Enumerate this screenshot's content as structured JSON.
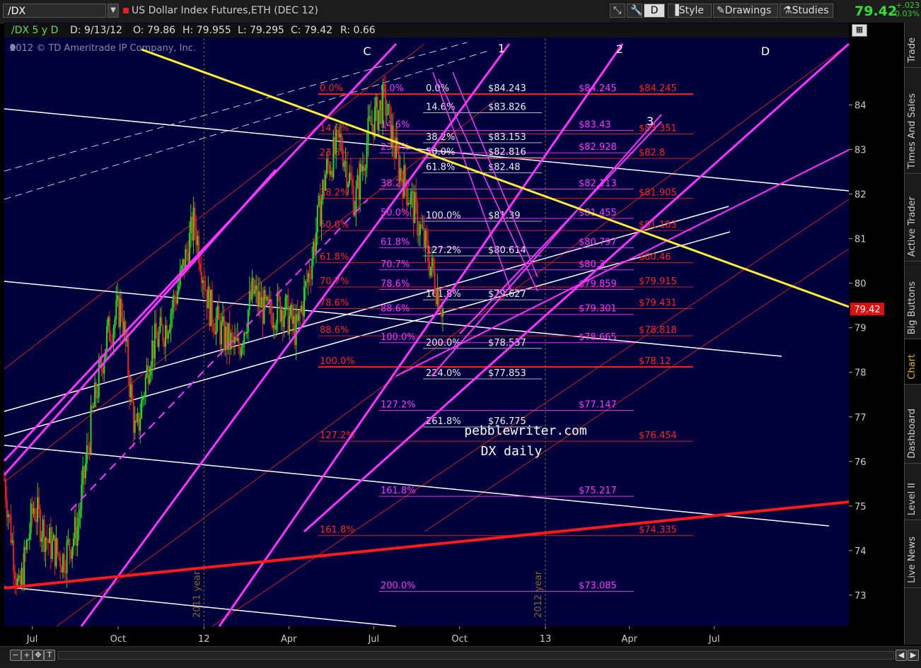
{
  "toolbar": {
    "symbol": "/DX",
    "description": "US Dollar Index Futures,ETH (DEC 12)",
    "aggregation_btn": "D",
    "style_label": "Style",
    "drawings_label": "Drawings",
    "studies_label": "Studies",
    "last_price": "79.42",
    "net_change": "+.023",
    "pct_change": "+0.03%"
  },
  "infobar": {
    "symbol_period": "/DX 5 y D",
    "date": "D: 9/13/12",
    "open": "O: 79.86",
    "high": "H: 79.955",
    "low": "L: 79.295",
    "close": "C: 79.42",
    "range": "R: 0.66"
  },
  "copyright": "2012 © TD Ameritrade IP Company, Inc.",
  "watermark": {
    "line1": "pebblewriter.com",
    "line2": "DX daily"
  },
  "right_tabs": [
    "Trade",
    "Times And Sales",
    "Active Trader",
    "Big Buttons",
    "Chart",
    "Dashboard",
    "Level II",
    "Live News"
  ],
  "colors": {
    "background": "#00003c",
    "bull": "#22dd22",
    "bear": "#ee2222",
    "magenta": "#ff33ff",
    "fib_red": "#ff2222",
    "yellow": "#ffee33",
    "price_label": "#dd1111"
  },
  "chart_data": {
    "type": "candlestick",
    "title": "US Dollar Index Futures,ETH (DEC 12)",
    "ylim": [
      72.3,
      85.5
    ],
    "y_ticks": [
      73,
      74,
      75,
      76,
      77,
      78,
      79,
      80,
      81,
      82,
      83,
      84
    ],
    "x_tick_labels": [
      "Jul",
      "Oct",
      "12",
      "Apr",
      "Jul",
      "Oct",
      "13",
      "Apr",
      "Jul"
    ],
    "current_price": "79.42",
    "year_markers": [
      "2011 year",
      "2012 year"
    ],
    "close_path": [
      {
        "t": "2011-06",
        "v": 75.6
      },
      {
        "t": "2011-06",
        "v": 73.0
      },
      {
        "t": "2011-07",
        "v": 75.0
      },
      {
        "t": "2011-07",
        "v": 74.2
      },
      {
        "t": "2011-08",
        "v": 73.8
      },
      {
        "t": "2011-08",
        "v": 74.5
      },
      {
        "t": "2011-09",
        "v": 77.0
      },
      {
        "t": "2011-09",
        "v": 78.8
      },
      {
        "t": "2011-10",
        "v": 79.5
      },
      {
        "t": "2011-10",
        "v": 76.5
      },
      {
        "t": "2011-11",
        "v": 78.5
      },
      {
        "t": "2011-11",
        "v": 79.0
      },
      {
        "t": "2011-12",
        "v": 80.0
      },
      {
        "t": "2012-01",
        "v": 81.4
      },
      {
        "t": "2012-01",
        "v": 79.5
      },
      {
        "t": "2012-02",
        "v": 78.8
      },
      {
        "t": "2012-02",
        "v": 78.5
      },
      {
        "t": "2012-03",
        "v": 79.8
      },
      {
        "t": "2012-03",
        "v": 79.3
      },
      {
        "t": "2012-04",
        "v": 79.5
      },
      {
        "t": "2012-04",
        "v": 78.9
      },
      {
        "t": "2012-05",
        "v": 80.5
      },
      {
        "t": "2012-05",
        "v": 82.5
      },
      {
        "t": "2012-06",
        "v": 83.2
      },
      {
        "t": "2012-06",
        "v": 81.8
      },
      {
        "t": "2012-07",
        "v": 83.5
      },
      {
        "t": "2012-07",
        "v": 84.1
      },
      {
        "t": "2012-08",
        "v": 82.6
      },
      {
        "t": "2012-08",
        "v": 81.7
      },
      {
        "t": "2012-09",
        "v": 80.6
      },
      {
        "t": "2012-09",
        "v": 79.42
      }
    ],
    "fib_red": [
      {
        "pct": "0.0%",
        "price": "$84.245",
        "value": 84.245
      },
      {
        "pct": "14.6%",
        "price": "$83.351",
        "value": 83.351
      },
      {
        "pct": "23.6%",
        "price": "$82.8",
        "value": 82.8
      },
      {
        "pct": "38.2%",
        "price": "$81.905",
        "value": 81.905
      },
      {
        "pct": "50.0%",
        "price": "$81.183",
        "value": 81.183
      },
      {
        "pct": "61.8%",
        "price": "$80.46",
        "value": 80.46
      },
      {
        "pct": "70.7%",
        "price": "$79.915",
        "value": 79.915
      },
      {
        "pct": "78.6%",
        "price": "$79.431",
        "value": 79.431
      },
      {
        "pct": "88.6%",
        "price": "$78.818",
        "value": 78.818
      },
      {
        "pct": "100.0%",
        "price": "$78.12",
        "value": 78.12
      },
      {
        "pct": "127.2%",
        "price": "$76.454",
        "value": 76.454
      },
      {
        "pct": "161.8%",
        "price": "$74.335",
        "value": 74.335
      }
    ],
    "fib_magenta": [
      {
        "pct": "0.0%",
        "price": "$84.245",
        "value": 84.245
      },
      {
        "pct": "14.6%",
        "price": "$83.43",
        "value": 83.43
      },
      {
        "pct": "23.6%",
        "price": "$82.928",
        "value": 82.928
      },
      {
        "pct": "38.2%",
        "price": "$82.113",
        "value": 82.113
      },
      {
        "pct": "50.0%",
        "price": "$81.455",
        "value": 81.455
      },
      {
        "pct": "61.8%",
        "price": "$80.797",
        "value": 80.797
      },
      {
        "pct": "70.7%",
        "price": "$80.3",
        "value": 80.3
      },
      {
        "pct": "78.6%",
        "price": "$79.859",
        "value": 79.859
      },
      {
        "pct": "88.6%",
        "price": "$79.301",
        "value": 79.301
      },
      {
        "pct": "100.0%",
        "price": "$78.665",
        "value": 78.665
      },
      {
        "pct": "127.2%",
        "price": "$77.147",
        "value": 77.147
      },
      {
        "pct": "161.8%",
        "price": "$75.217",
        "value": 75.217
      },
      {
        "pct": "200.0%",
        "price": "$73.085",
        "value": 73.085
      }
    ],
    "fib_white": [
      {
        "pct": "0.0%",
        "price": "$84.243",
        "value": 84.243
      },
      {
        "pct": "14.6%",
        "price": "$83.826",
        "value": 83.826
      },
      {
        "pct": "38.2%",
        "price": "$83.153",
        "value": 83.153
      },
      {
        "pct": "50.0%",
        "price": "$82.816",
        "value": 82.816
      },
      {
        "pct": "61.8%",
        "price": "$82.48",
        "value": 82.48
      },
      {
        "pct": "100.0%",
        "price": "$81.39",
        "value": 81.39
      },
      {
        "pct": "127.2%",
        "price": "$80.614",
        "value": 80.614
      },
      {
        "pct": "161.8%",
        "price": "$79.627",
        "value": 79.627
      },
      {
        "pct": "200.0%",
        "price": "$78.537",
        "value": 78.537
      },
      {
        "pct": "224.0%",
        "price": "$77.853",
        "value": 77.853
      },
      {
        "pct": "261.8%",
        "price": "$76.775",
        "value": 76.775
      }
    ],
    "wave_labels": [
      "C",
      "1",
      "2",
      "D",
      "3"
    ]
  }
}
